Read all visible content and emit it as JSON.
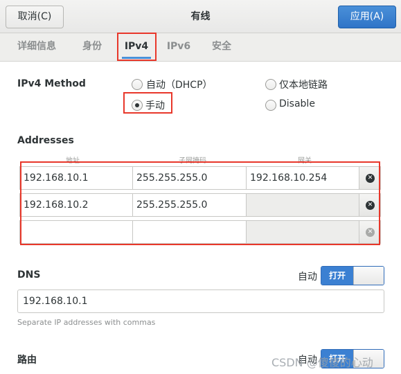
{
  "header": {
    "cancel_label": "取消(C)",
    "title": "有线",
    "apply_label": "应用(A)"
  },
  "tabs": [
    {
      "label": "详细信息"
    },
    {
      "label": "身份"
    },
    {
      "label": "IPv4"
    },
    {
      "label": "IPv6"
    },
    {
      "label": "安全"
    }
  ],
  "active_tab": "IPv4",
  "ipv4_method": {
    "label": "IPv4 Method",
    "options": [
      {
        "label": "自动（DHCP）",
        "checked": false
      },
      {
        "label": "仅本地链路",
        "checked": false
      },
      {
        "label": "手动",
        "checked": true
      },
      {
        "label": "Disable",
        "checked": false
      }
    ]
  },
  "addresses": {
    "label": "Addresses",
    "columns": [
      "地址",
      "子网掩码",
      "网关"
    ],
    "rows": [
      {
        "address": "192.168.10.1",
        "netmask": "255.255.255.0",
        "gateway": "192.168.10.254"
      },
      {
        "address": "192.168.10.2",
        "netmask": "255.255.255.0",
        "gateway": ""
      },
      {
        "address": "",
        "netmask": "",
        "gateway": ""
      }
    ]
  },
  "dns": {
    "label": "DNS",
    "auto_label": "自动",
    "switch_label": "打开",
    "value": "192.168.10.1",
    "hint": "Separate IP addresses with commas"
  },
  "routes": {
    "label": "路由",
    "auto_label": "自动",
    "switch_label": "打开"
  },
  "watermark": "CSDN @傻傻的心动",
  "colors": {
    "accent": "#4a90d9",
    "annotation_red": "#e8372a"
  }
}
